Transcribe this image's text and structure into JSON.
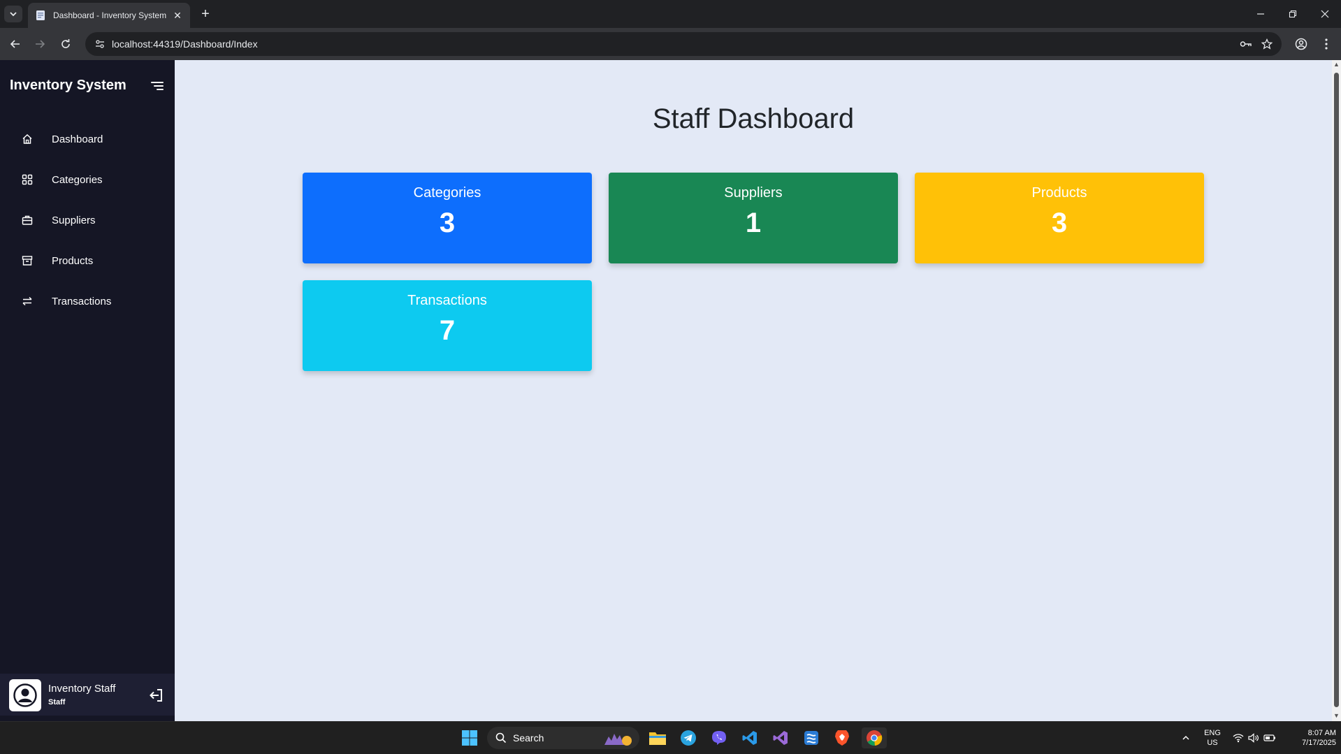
{
  "browser": {
    "tab_title": "Dashboard - Inventory System",
    "url": "localhost:44319/Dashboard/Index"
  },
  "sidebar": {
    "brand": "Inventory System",
    "items": [
      {
        "label": "Dashboard",
        "icon": "home-icon"
      },
      {
        "label": "Categories",
        "icon": "grid-icon"
      },
      {
        "label": "Suppliers",
        "icon": "briefcase-icon"
      },
      {
        "label": "Products",
        "icon": "archive-icon"
      },
      {
        "label": "Transactions",
        "icon": "swap-icon"
      }
    ],
    "user": {
      "name": "Inventory Staff",
      "role": "Staff"
    }
  },
  "main": {
    "title": "Staff Dashboard",
    "cards": [
      {
        "label": "Categories",
        "value": "3",
        "color": "#0d6efd"
      },
      {
        "label": "Suppliers",
        "value": "1",
        "color": "#198754"
      },
      {
        "label": "Products",
        "value": "3",
        "color": "#ffc107"
      },
      {
        "label": "Transactions",
        "value": "7",
        "color": "#0dcaf0"
      }
    ]
  },
  "taskbar": {
    "search_label": "Search",
    "lang_line1": "ENG",
    "lang_line2": "US",
    "time": "8:07 AM",
    "date": "7/17/2025"
  }
}
